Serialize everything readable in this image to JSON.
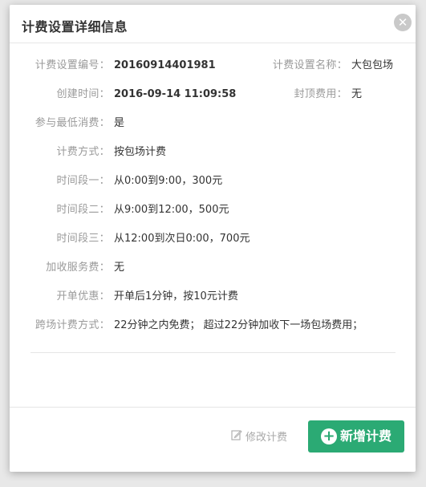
{
  "dialog": {
    "title": "计费设置详细信息",
    "close_symbol": "✕"
  },
  "details": {
    "setting_id_label": "计费设置编号：",
    "setting_id_value": "20160914401981",
    "setting_name_label": "计费设置名称：",
    "setting_name_value": "大包包场",
    "created_label": "创建时间：",
    "created_value": "2016-09-14 11:09:58",
    "cap_fee_label": "封顶费用：",
    "cap_fee_value": "无",
    "min_consume_label": "参与最低消费：",
    "min_consume_value": "是",
    "billing_method_label": "计费方式：",
    "billing_method_value": "按包场计费",
    "period1_label": "时间段一：",
    "period1_value": "从0:00到9:00，300元",
    "period2_label": "时间段二：",
    "period2_value": "从9:00到12:00，500元",
    "period3_label": "时间段三：",
    "period3_value": "从12:00到次日0:00，700元",
    "service_fee_label": "加收服务费：",
    "service_fee_value": "无",
    "open_discount_label": "开单优惠：",
    "open_discount_value": "开单后1分钟，按10元计费",
    "cross_billing_label": "跨场计费方式：",
    "cross_billing_value": "22分钟之内免费；  超过22分钟加收下一场包场费用；"
  },
  "footer": {
    "edit_label": "修改计费",
    "add_label": "新增计费"
  },
  "colors": {
    "accent": "#2baa74",
    "label": "#9a9a9a",
    "value": "#333333"
  },
  "icons": {
    "close": "close-icon",
    "edit": "edit-icon",
    "add": "plus-circle-icon"
  }
}
